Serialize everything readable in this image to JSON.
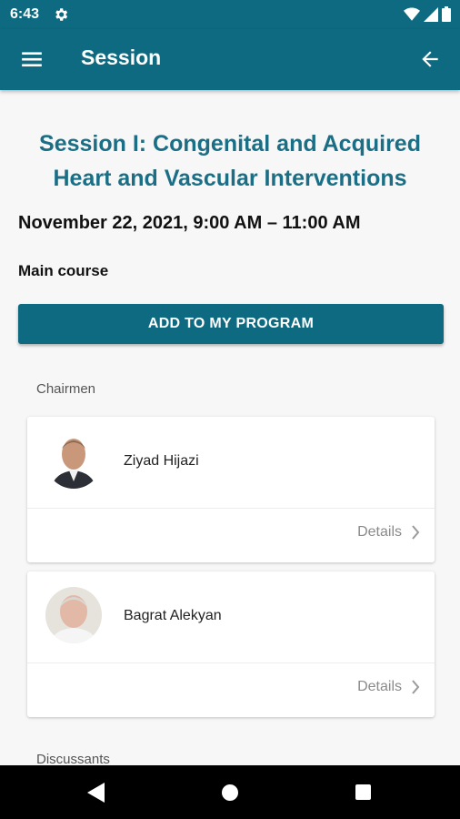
{
  "status_bar": {
    "time": "6:43"
  },
  "app_bar": {
    "title": "Session"
  },
  "session": {
    "title": "Session I: Congenital and Acquired Heart and Vascular Interventions",
    "datetime": "November 22, 2021, 9:00 AM – 11:00 AM",
    "type": "Main course",
    "add_button_label": "ADD TO MY PROGRAM"
  },
  "sections": {
    "chairmen_label": "Chairmen",
    "discussants_label": "Discussants"
  },
  "chairmen": [
    {
      "name": "Ziyad Hijazi",
      "details_label": "Details"
    },
    {
      "name": "Bagrat Alekyan",
      "details_label": "Details"
    }
  ],
  "colors": {
    "primary": "#0e6a80",
    "title_text": "#1a6e85",
    "background": "#f7f7f7"
  }
}
